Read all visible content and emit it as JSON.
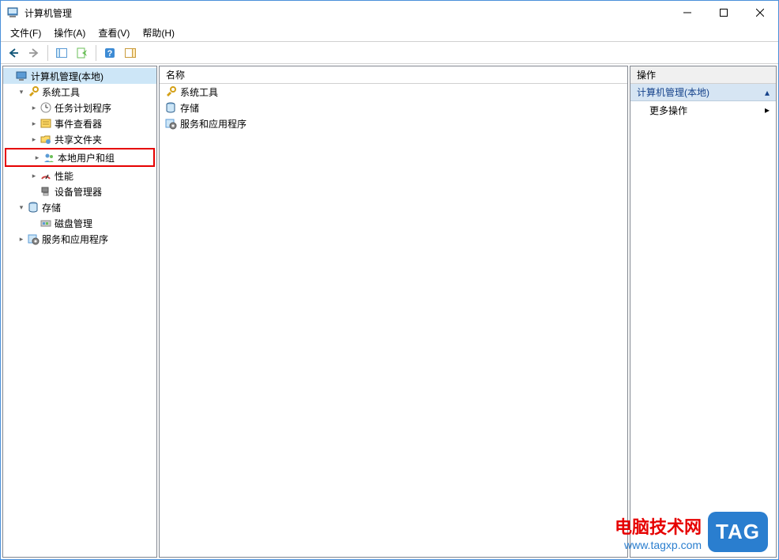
{
  "window": {
    "title": "计算机管理"
  },
  "menu": {
    "file": "文件(F)",
    "action": "操作(A)",
    "view": "查看(V)",
    "help": "帮助(H)"
  },
  "tree": {
    "root": "计算机管理(本地)",
    "system_tools": "系统工具",
    "task_scheduler": "任务计划程序",
    "event_viewer": "事件查看器",
    "shared_folders": "共享文件夹",
    "local_users": "本地用户和组",
    "performance": "性能",
    "device_manager": "设备管理器",
    "storage": "存储",
    "disk_management": "磁盘管理",
    "services_apps": "服务和应用程序"
  },
  "main": {
    "column_name": "名称",
    "items": {
      "system_tools": "系统工具",
      "storage": "存储",
      "services_apps": "服务和应用程序"
    }
  },
  "actions": {
    "header": "操作",
    "scope": "计算机管理(本地)",
    "more": "更多操作"
  },
  "watermark": {
    "line1": "电脑技术网",
    "line2": "www.tagxp.com",
    "badge": "TAG"
  }
}
